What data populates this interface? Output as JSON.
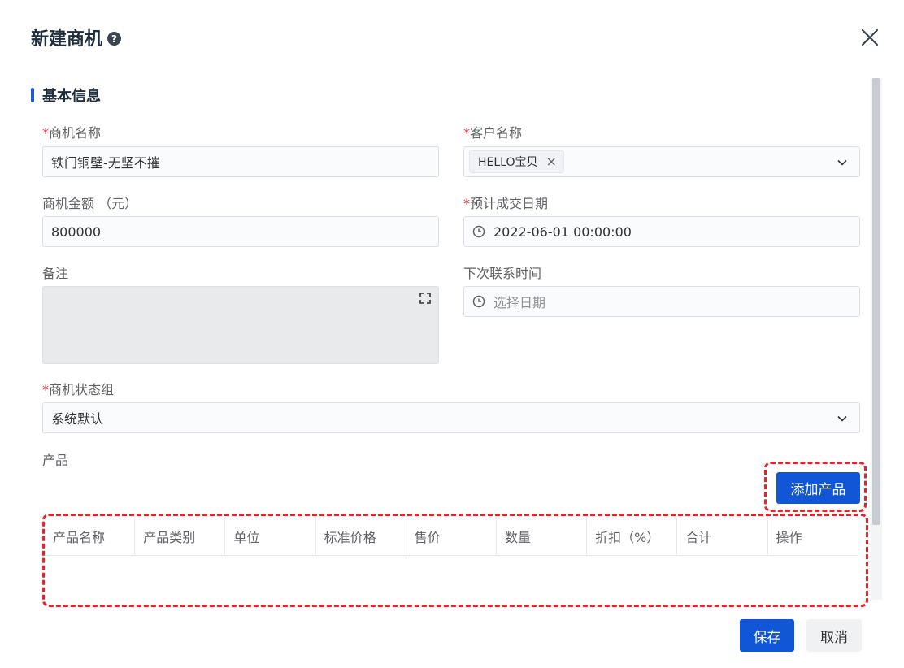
{
  "dialog": {
    "title": "新建商机",
    "help_icon": "?"
  },
  "section": {
    "title": "基本信息"
  },
  "fields": {
    "opportunity_name": {
      "required_mark": "*",
      "label": "商机名称",
      "value": "铁门铜壁-无坚不摧"
    },
    "customer_name": {
      "required_mark": "*",
      "label": "客户名称",
      "tag": "HELLO宝贝",
      "tag_close": "×"
    },
    "amount": {
      "label": "商机金额 （元）",
      "value": "800000"
    },
    "expected_date": {
      "required_mark": "*",
      "label": "预计成交日期",
      "value": "2022-06-01 00:00:00"
    },
    "remark": {
      "label": "备注"
    },
    "next_contact": {
      "label": "下次联系时间",
      "placeholder": "选择日期"
    },
    "status_group": {
      "required_mark": "*",
      "label": "商机状态组",
      "value": "系统默认"
    },
    "products": {
      "label": "产品"
    }
  },
  "buttons": {
    "add_product": "添加产品",
    "save": "保存",
    "cancel": "取消"
  },
  "table": {
    "columns": [
      "产品名称",
      "产品类别",
      "单位",
      "标准价格",
      "售价",
      "数量",
      "折扣（%）",
      "合计",
      "操作"
    ]
  },
  "colors": {
    "primary": "#1056d6",
    "required": "#e0383e",
    "highlight": "#e0262b"
  }
}
